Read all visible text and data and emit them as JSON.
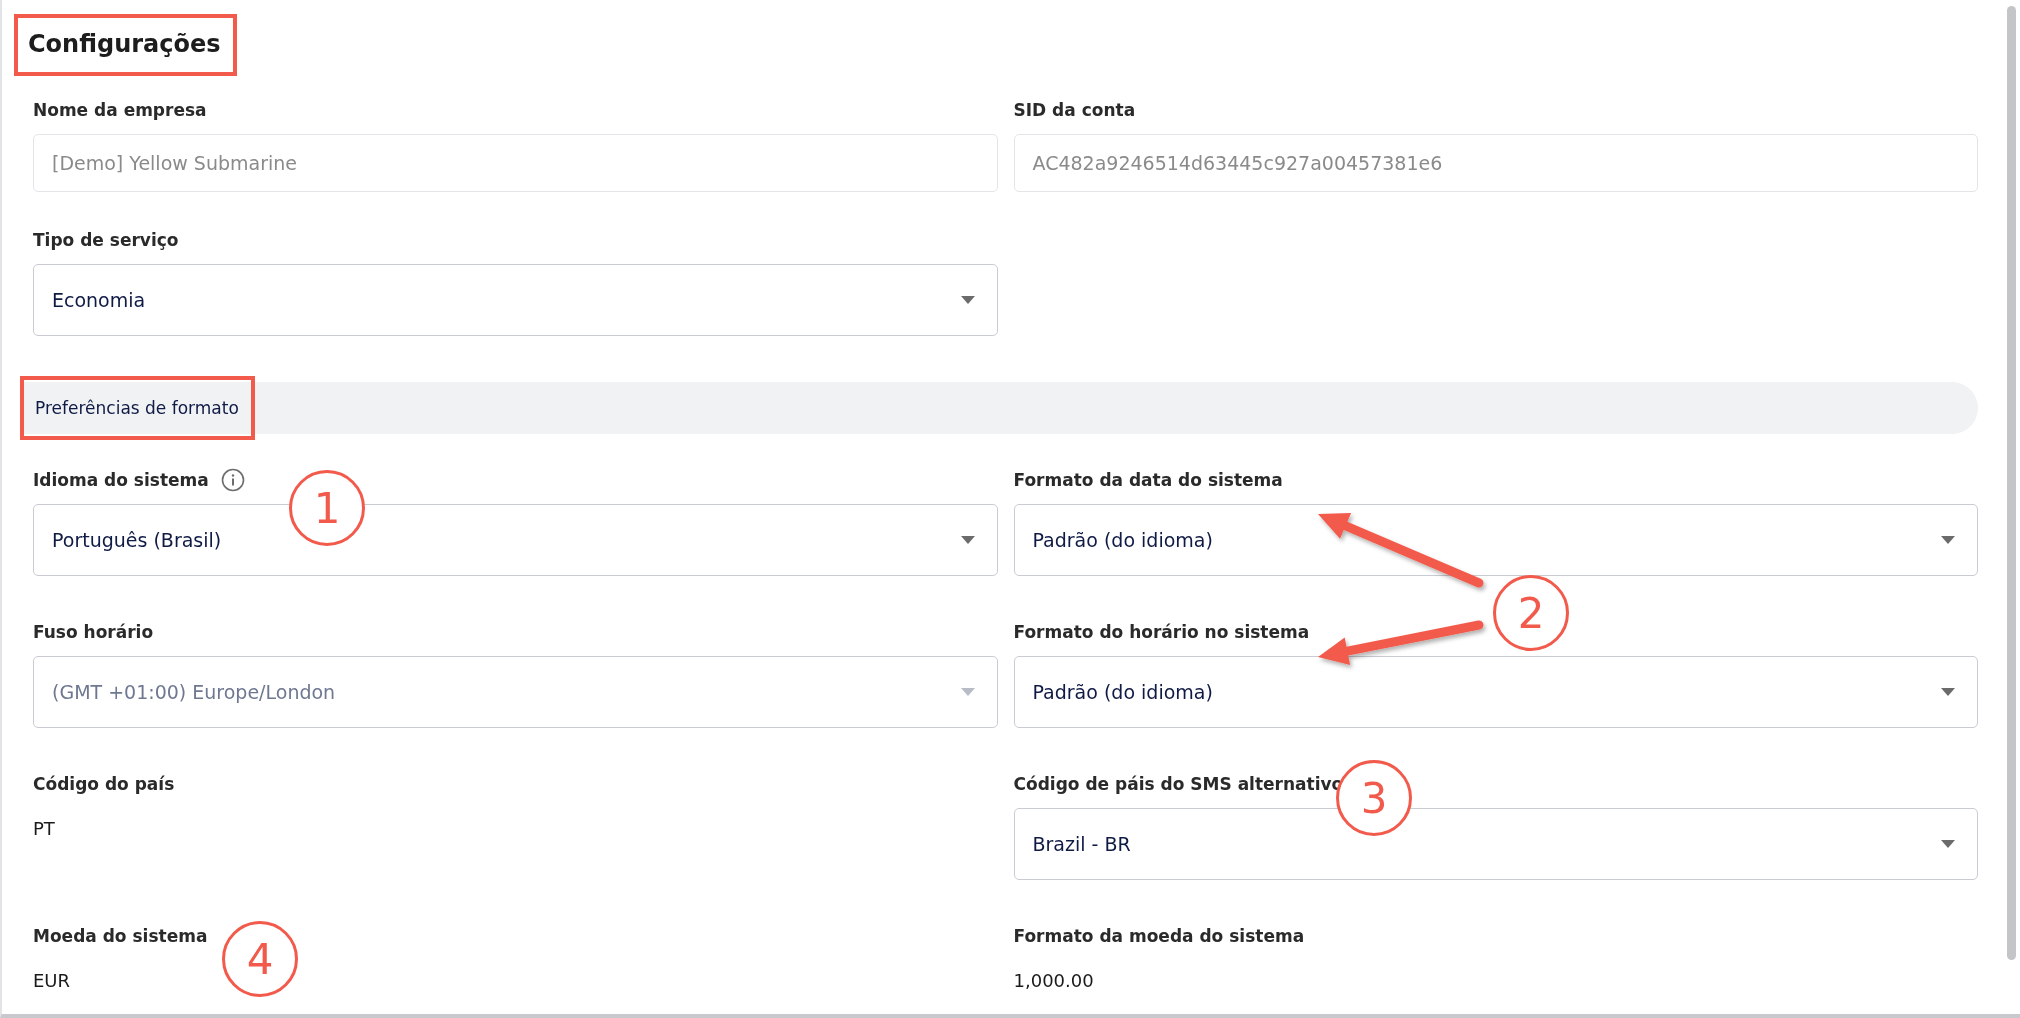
{
  "title": {
    "text": "Configurações",
    "highlighted": true
  },
  "rows_top": [
    {
      "fields": [
        {
          "kind": "input",
          "label": "Nome da empresa",
          "value": "[Demo] Yellow Submarine",
          "disabled": true
        },
        {
          "kind": "input",
          "label": "SID da conta",
          "value": "AC482a9246514d63445c927a00457381e6",
          "disabled": true
        }
      ]
    },
    {
      "fields": [
        {
          "kind": "select",
          "label": "Tipo de serviço",
          "value": "Economia",
          "disabled": false
        }
      ]
    }
  ],
  "section": {
    "title": "Preferências de formato",
    "highlighted": true
  },
  "rows": [
    {
      "fields": [
        {
          "kind": "select",
          "label": "Idioma do sistema",
          "value": "Português (Brasil)",
          "disabled": false,
          "info": true
        },
        {
          "kind": "select",
          "label": "Formato da data do sistema",
          "value": "Padrão (do idioma)",
          "disabled": false
        }
      ]
    },
    {
      "fields": [
        {
          "kind": "select",
          "label": "Fuso horário",
          "value": "(GMT +01:00) Europe/London",
          "disabled": true
        },
        {
          "kind": "select",
          "label": "Formato do horário no sistema",
          "value": "Padrão (do idioma)",
          "disabled": false
        }
      ]
    },
    {
      "fields": [
        {
          "kind": "text",
          "label": "Código do país",
          "value": "PT"
        },
        {
          "kind": "select",
          "label": "Código de páis do SMS alternativo",
          "value": "Brazil - BR",
          "disabled": false
        }
      ]
    },
    {
      "fields": [
        {
          "kind": "text",
          "label": "Moeda do sistema",
          "value": "EUR"
        },
        {
          "kind": "text",
          "label": "Formato da moeda do sistema",
          "value": "1,000.00"
        }
      ]
    }
  ],
  "callouts": [
    {
      "kind": "circle",
      "number": "1"
    },
    {
      "kind": "circle_with_arrows",
      "number": "2"
    },
    {
      "kind": "circle",
      "number": "3"
    },
    {
      "kind": "circle",
      "number": "4"
    }
  ]
}
